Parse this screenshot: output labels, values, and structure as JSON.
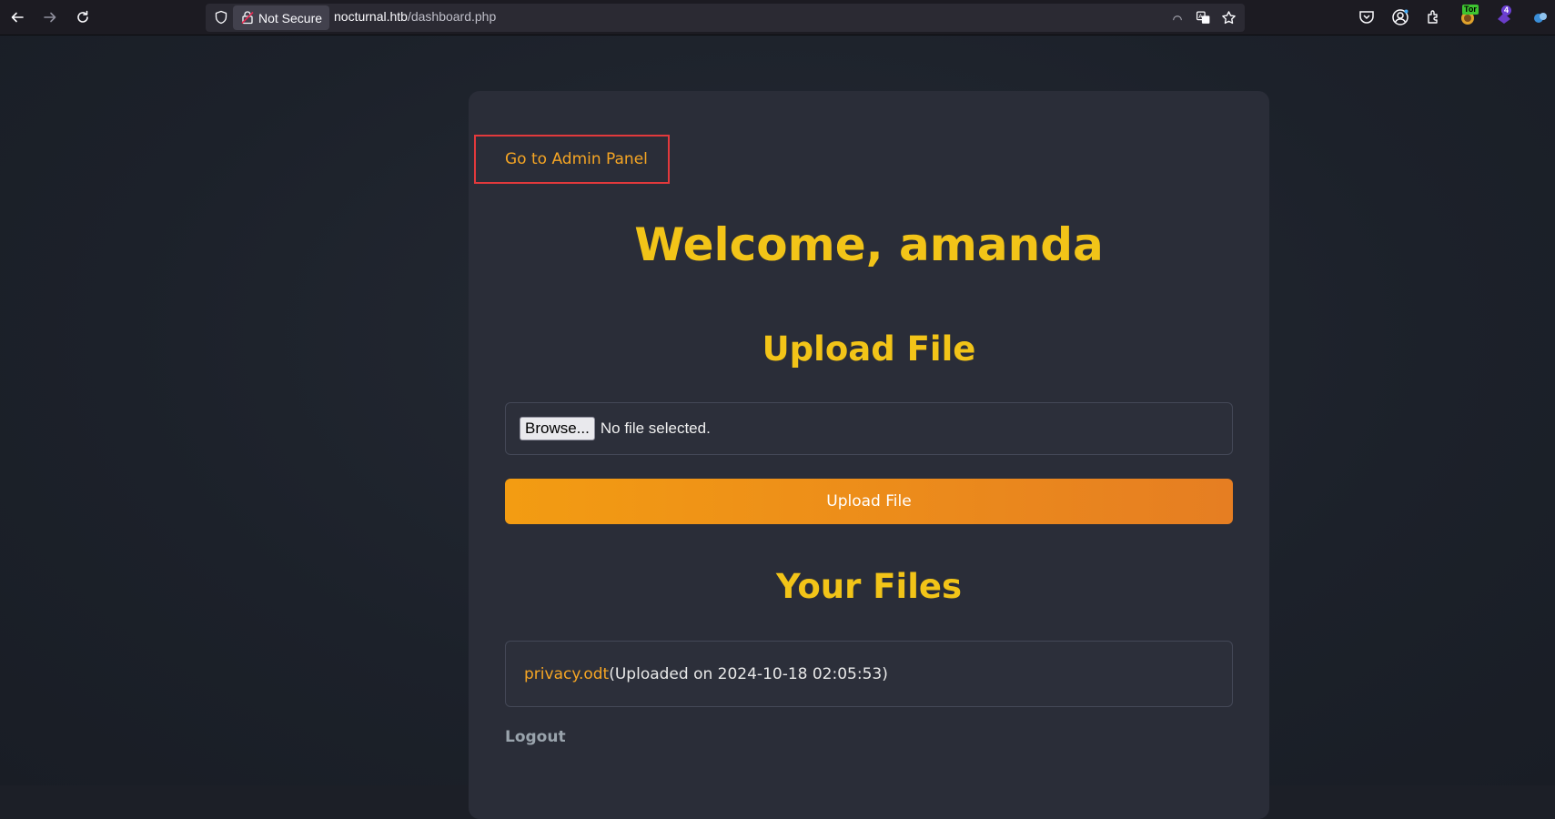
{
  "browser": {
    "security_label": "Not Secure",
    "url_host": "nocturnal.htb",
    "url_path": "/dashboard.php",
    "tor_badge": "Tor",
    "extension_badge": "4"
  },
  "page": {
    "admin_link": "Go to Admin Panel",
    "welcome": "Welcome, amanda",
    "upload_heading": "Upload File",
    "browse_label": "Browse...",
    "file_status": "No file selected.",
    "upload_button": "Upload File",
    "files_heading": "Your Files",
    "files": [
      {
        "name": "privacy.odt",
        "meta": " (Uploaded on 2024-10-18 02:05:53)"
      }
    ],
    "logout": "Logout"
  },
  "colors": {
    "accent_yellow": "#f2c418",
    "link_orange": "#f5a524",
    "highlight_red": "#e2393c",
    "button_gradient_start": "#f39c12",
    "button_gradient_end": "#e67e22"
  }
}
